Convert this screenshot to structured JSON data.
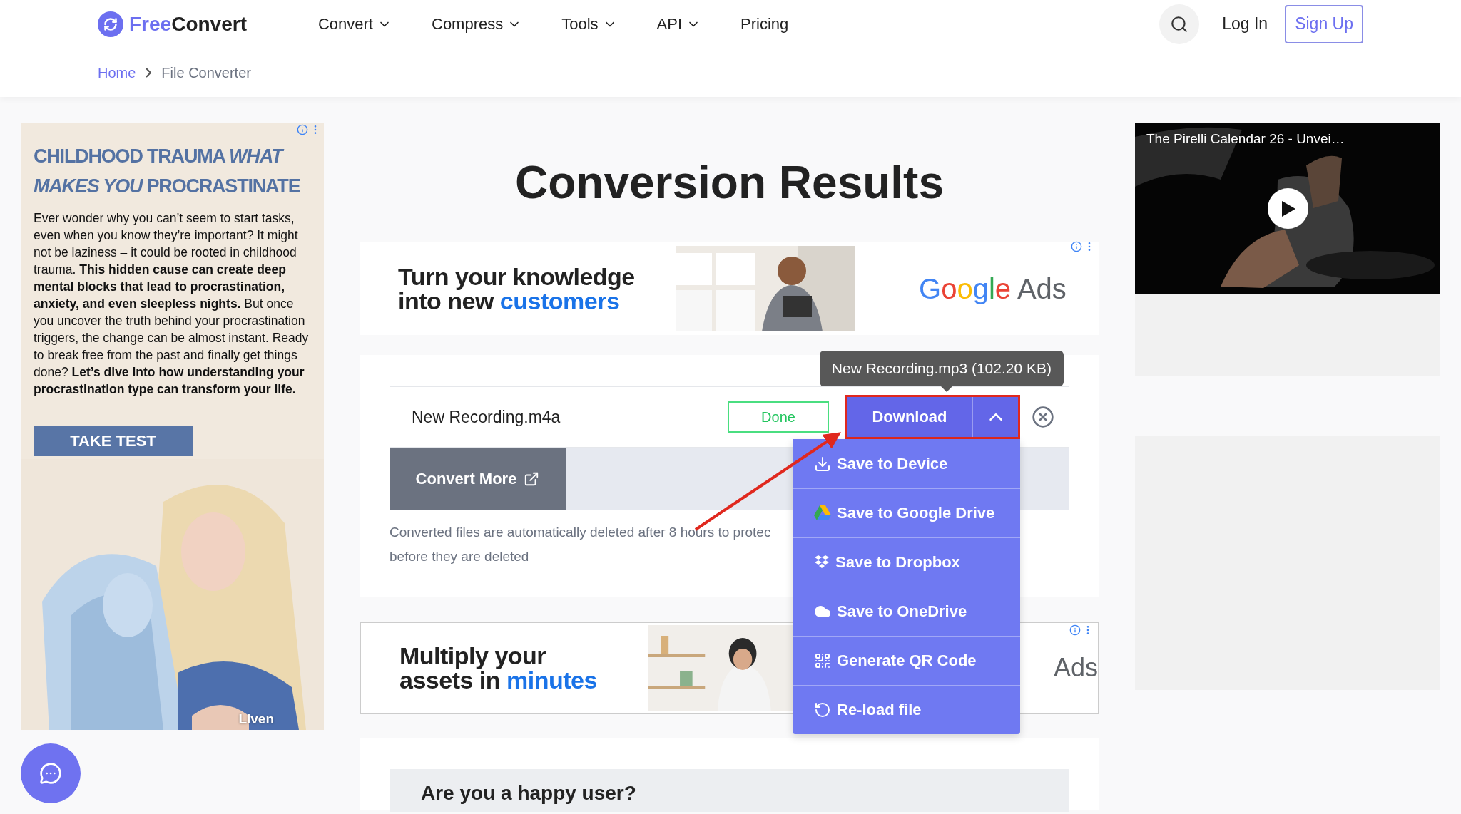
{
  "header": {
    "logo": {
      "part_1": "Free",
      "part_2": "Convert"
    },
    "nav": [
      {
        "label": "Convert",
        "dropdown": true
      },
      {
        "label": "Compress",
        "dropdown": true
      },
      {
        "label": "Tools",
        "dropdown": true
      },
      {
        "label": "API",
        "dropdown": true
      },
      {
        "label": "Pricing",
        "dropdown": false
      }
    ],
    "login": "Log In",
    "signup": "Sign Up"
  },
  "breadcrumb": [
    "Home",
    "File Converter"
  ],
  "left_ad": {
    "headline": "CHILDHOOD TRAUMA *WHAT MAKES YOU* PROCRASTINATE",
    "body": "Ever wonder why you can’t seem to start tasks, even when you know they’re important? It might not be laziness – it could be rooted in childhood trauma. **This hidden cause can create deep mental blocks that lead to procrastination, anxiety, and even sleepless nights.** But once you uncover the truth behind your procrastination triggers, the change can be almost instant. Ready to break free from the past and finally get things done? **Let’s dive into how understanding your procrastination type can transform your life.**",
    "button": "TAKE TEST",
    "brand": "Liven"
  },
  "title": "Conversion Results",
  "ad_top": {
    "line_1": "Turn your knowledge",
    "line_2": "into new",
    "highlight": "customers",
    "brand": "Google Ads"
  },
  "file": {
    "name": "New Recording.m4a",
    "status": "Done",
    "download": "Download",
    "menu_expanded": true,
    "tooltip": "New Recording.mp3 (102.20 KB)"
  },
  "menu": [
    {
      "label": "Save to Device",
      "kind": "download"
    },
    {
      "label": "Save to Google Drive",
      "kind": "drive"
    },
    {
      "label": "Save to Dropbox",
      "kind": "dropbox"
    },
    {
      "label": "Save to OneDrive",
      "kind": "cloud"
    },
    {
      "label": "Generate QR Code",
      "kind": "qr"
    },
    {
      "label": "Re-load file",
      "kind": "reload"
    }
  ],
  "convert_more": "Convert More",
  "notice": [
    "Converted files are automatically deleted after 8 hours to protec",
    "before they are deleted"
  ],
  "ad_bottom": {
    "line_1": "Multiply your",
    "line_2": "assets in",
    "highlight": "minutes",
    "brand_fragment": "Ads"
  },
  "feedback": {
    "title": "Are you a happy user?"
  },
  "video": {
    "title": "The Pirelli Calendar 26 - Unvei…"
  }
}
